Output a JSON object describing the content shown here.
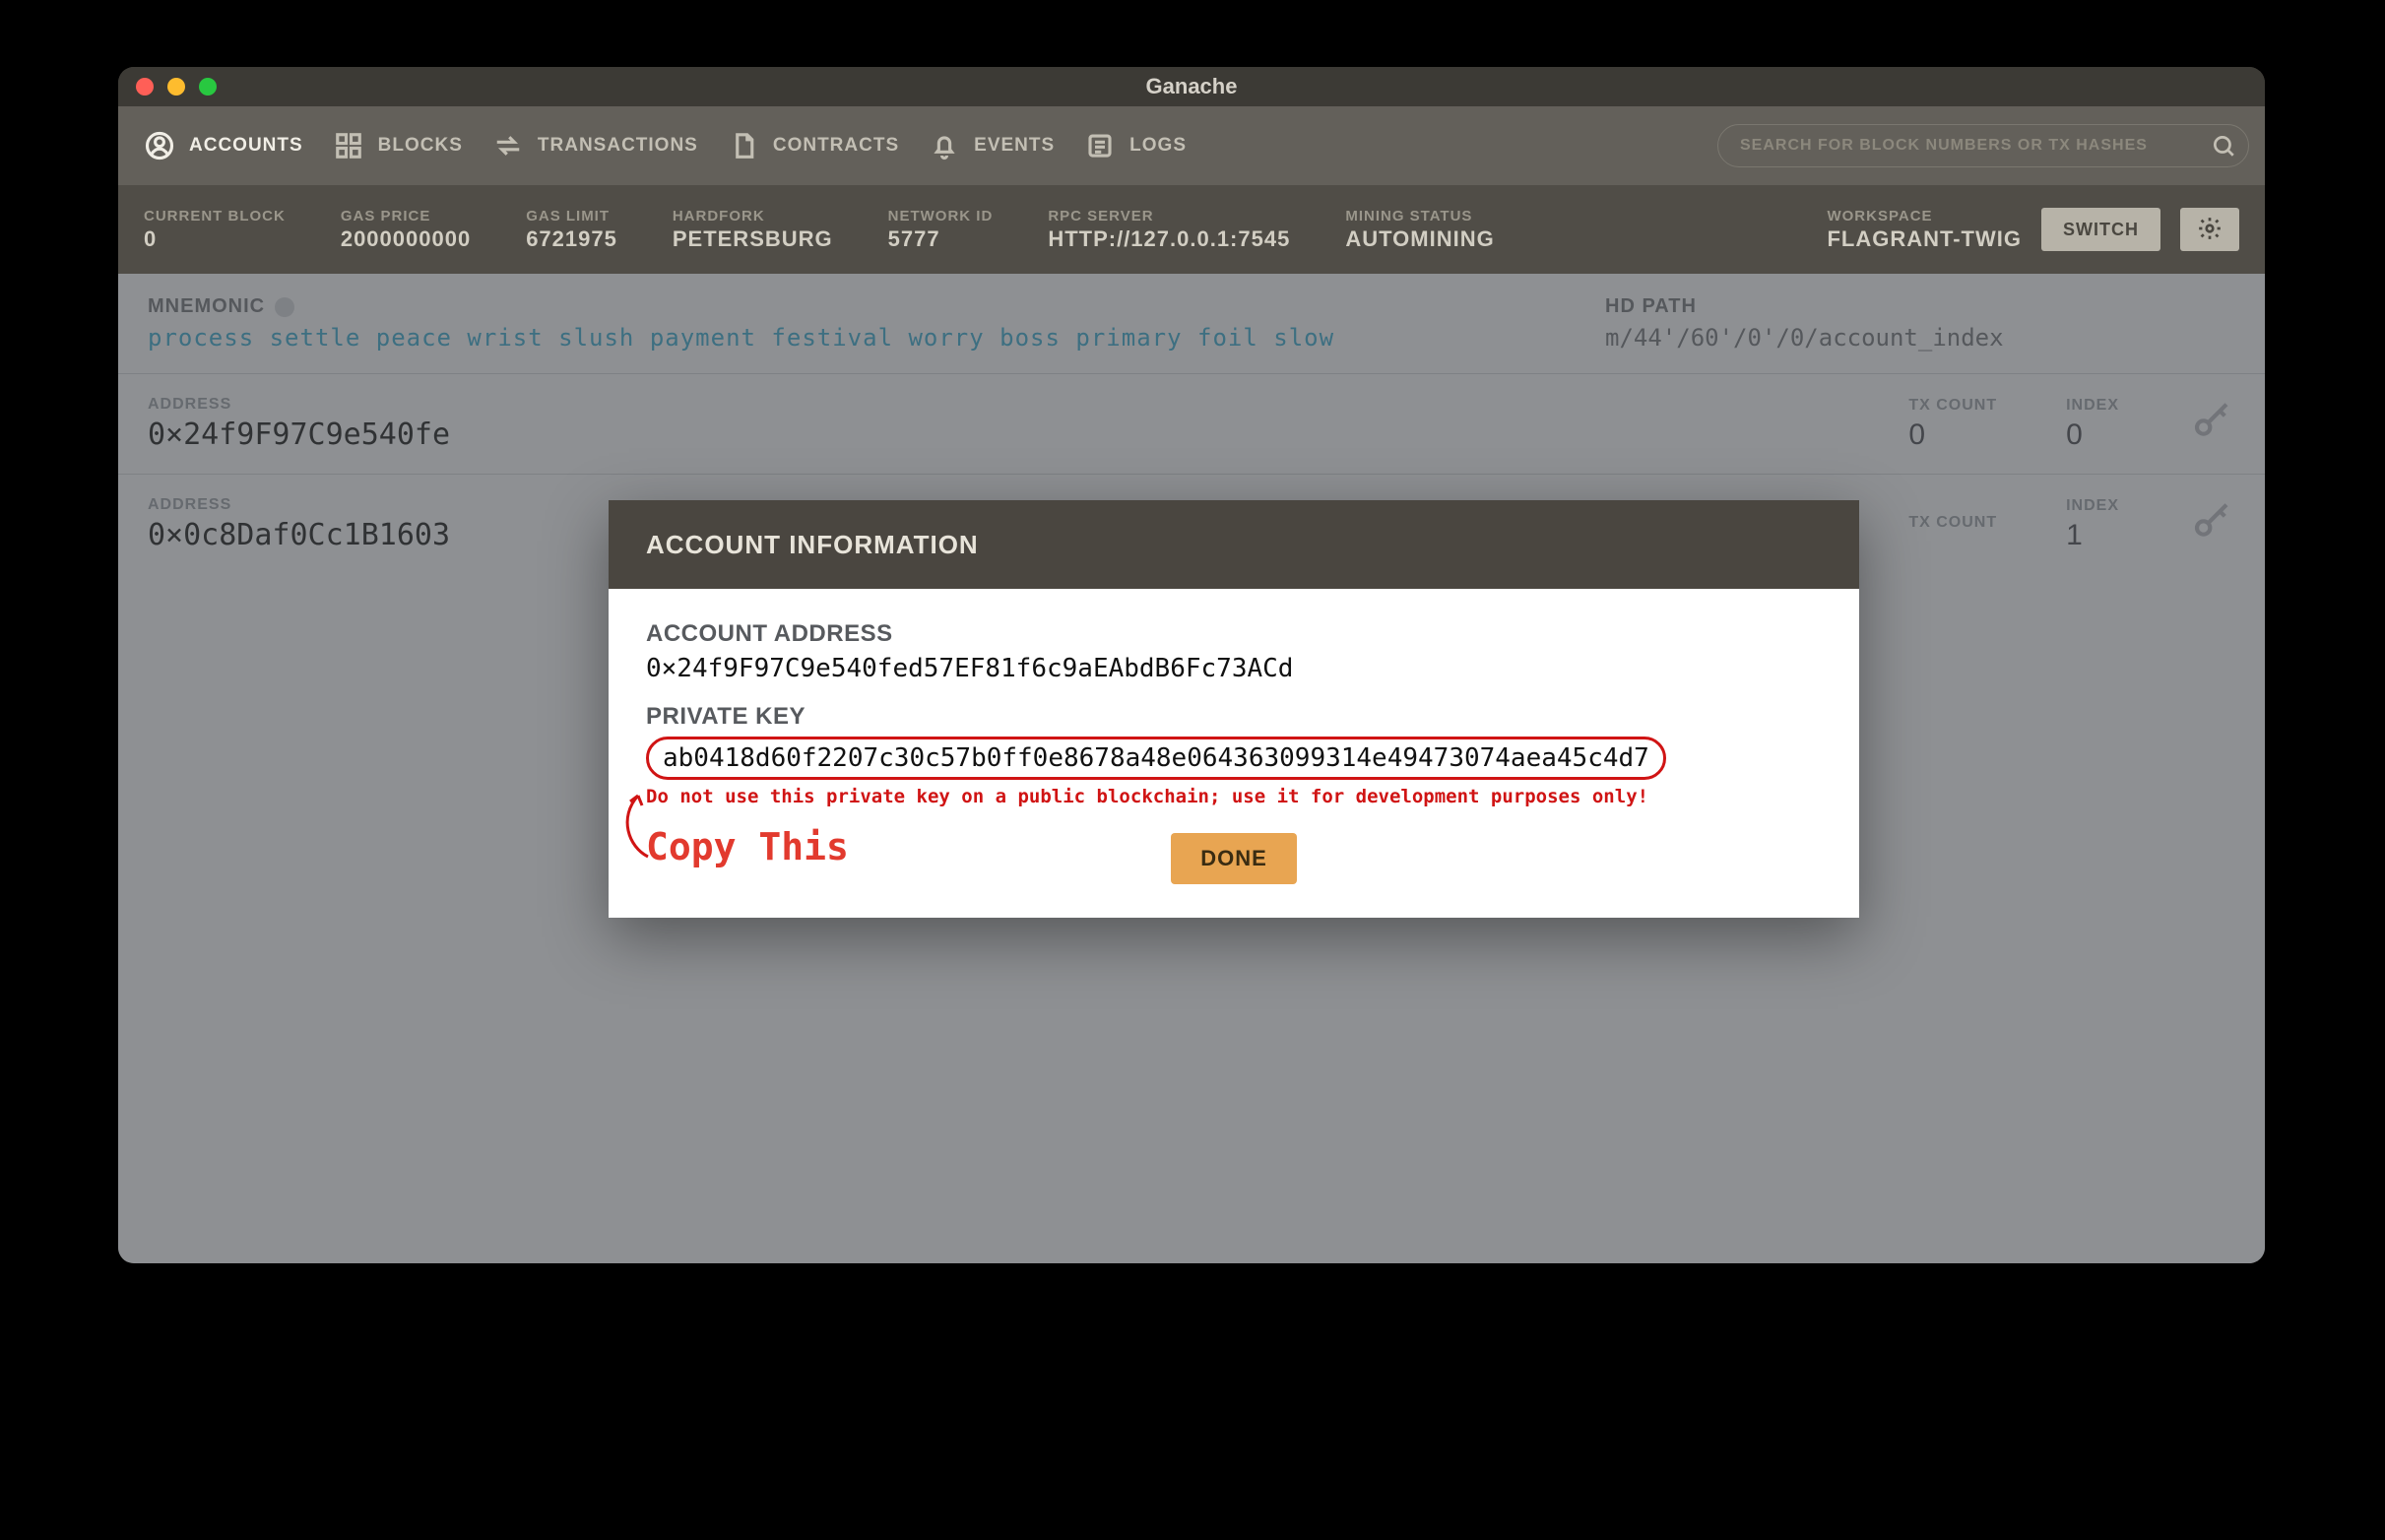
{
  "window": {
    "title": "Ganache"
  },
  "nav": {
    "items": [
      {
        "label": "ACCOUNTS",
        "icon": "user"
      },
      {
        "label": "BLOCKS",
        "icon": "grid"
      },
      {
        "label": "TRANSACTIONS",
        "icon": "swap"
      },
      {
        "label": "CONTRACTS",
        "icon": "doc"
      },
      {
        "label": "EVENTS",
        "icon": "bell"
      },
      {
        "label": "LOGS",
        "icon": "list"
      }
    ],
    "search_placeholder": "SEARCH FOR BLOCK NUMBERS OR TX HASHES"
  },
  "status": {
    "current_block": {
      "label": "CURRENT BLOCK",
      "value": "0"
    },
    "gas_price": {
      "label": "GAS PRICE",
      "value": "2000000000"
    },
    "gas_limit": {
      "label": "GAS LIMIT",
      "value": "6721975"
    },
    "hardfork": {
      "label": "HARDFORK",
      "value": "PETERSBURG"
    },
    "network_id": {
      "label": "NETWORK ID",
      "value": "5777"
    },
    "rpc_server": {
      "label": "RPC SERVER",
      "value": "HTTP://127.0.0.1:7545"
    },
    "mining_status": {
      "label": "MINING STATUS",
      "value": "AUTOMINING"
    },
    "workspace": {
      "label": "WORKSPACE",
      "value": "FLAGRANT-TWIG"
    },
    "switch_label": "SWITCH"
  },
  "mnemonic": {
    "label": "MNEMONIC",
    "text": "process settle peace wrist slush payment festival worry boss primary foil slow"
  },
  "hdpath": {
    "label": "HD PATH",
    "value": "m/44'/60'/0'/0/account_index"
  },
  "accounts": [
    {
      "address_label": "ADDRESS",
      "address": "0×24f9F97C9e540fe",
      "txcount_label": "TX COUNT",
      "txcount": "0",
      "index_label": "INDEX",
      "index": "0"
    },
    {
      "address_label": "ADDRESS",
      "address": "0×0c8Daf0Cc1B1603",
      "txcount_label": "TX COUNT",
      "txcount": "",
      "index_label": "INDEX",
      "index": "1"
    }
  ],
  "modal": {
    "title": "ACCOUNT INFORMATION",
    "addr_label": "ACCOUNT ADDRESS",
    "addr": "0×24f9F97C9e540fed57EF81f6c9aEAbdB6Fc73ACd",
    "pk_label": "PRIVATE KEY",
    "pk": "ab0418d60f2207c30c57b0ff0e8678a48e064363099314e49473074aea45c4d7",
    "warning": "Do not use this private key on a public blockchain; use it for development purposes only!",
    "copy_hint": "Copy This",
    "done_label": "DONE"
  }
}
